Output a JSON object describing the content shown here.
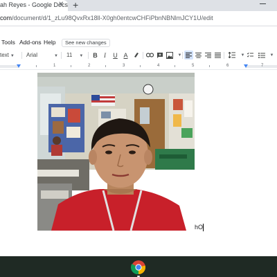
{
  "browser": {
    "tab_title": "ah Reyes - Google Docs",
    "tab_close": "✕",
    "new_tab": "+",
    "url_host": "com",
    "url_path": "/document/d/1_zLu98QvxRx18ll-X0gh0entcwCHFiPbnNBNlmJCY1U/edit"
  },
  "menu": {
    "items": [
      "Tools",
      "Add-ons",
      "Help"
    ],
    "save_status": "See new changes"
  },
  "toolbar": {
    "style": "text",
    "font": "Arial",
    "font_size": "11",
    "bold": "B",
    "italic": "I",
    "underline": "U",
    "text_color": "A"
  },
  "ruler": {
    "numbers": [
      "1",
      "2",
      "3",
      "4",
      "5",
      "6",
      "7"
    ]
  },
  "document": {
    "typed_text": "hO"
  },
  "colors": {
    "accent": "#4285f4",
    "taskbar": "#1f2a24",
    "shirt": "#c8202a"
  },
  "icons": [
    "chrome-icon",
    "link-icon",
    "add-comment-icon",
    "insert-image-icon",
    "align-left-icon",
    "align-center-icon",
    "align-right-icon",
    "justify-icon",
    "line-spacing-icon",
    "bulleted-list-icon",
    "numbered-list-icon",
    "highlighter-icon"
  ]
}
